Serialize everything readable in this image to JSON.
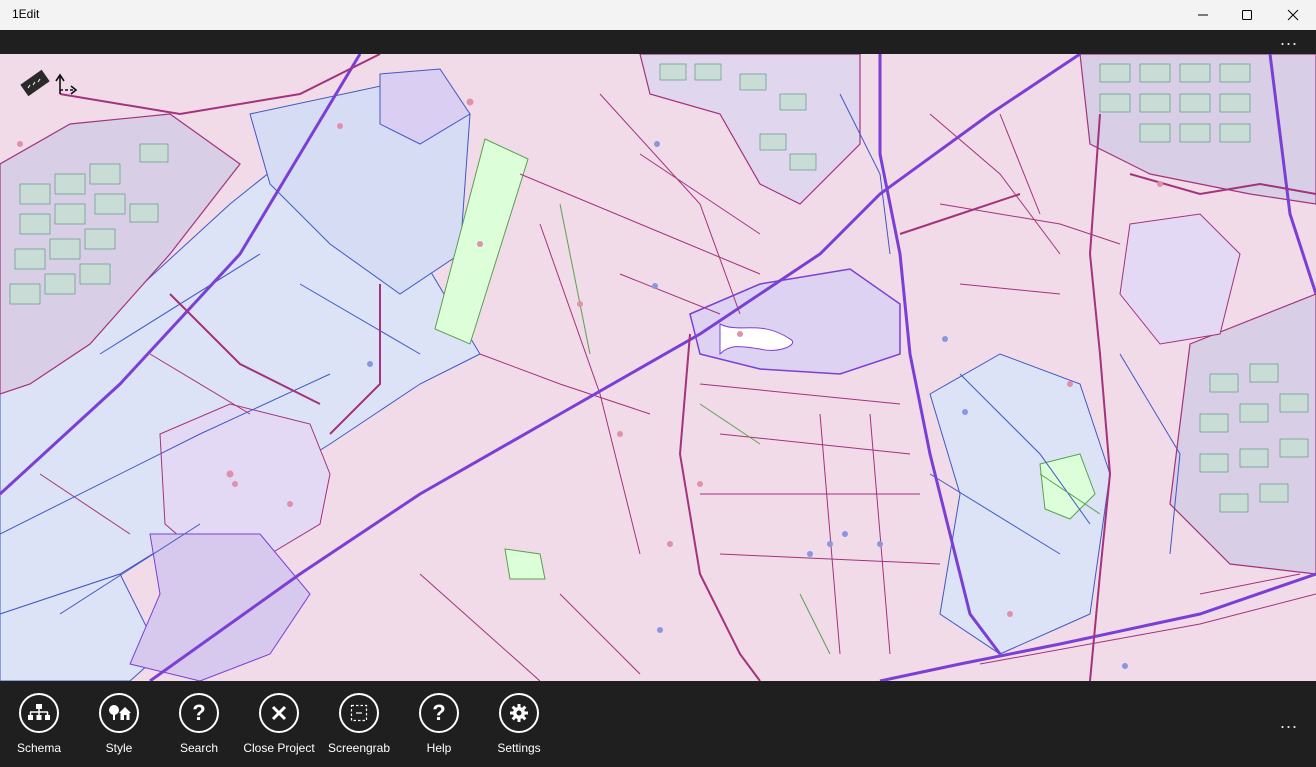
{
  "window": {
    "title": "1Edit",
    "controls": {
      "minimize_icon": "minimize-icon",
      "maximize_icon": "maximize-icon",
      "close_icon": "close-icon"
    }
  },
  "topbar": {
    "more": "..."
  },
  "map": {
    "tools": [
      {
        "name": "measure-ruler",
        "icon": "ruler-icon"
      },
      {
        "name": "coordinate-axes",
        "icon": "axes-icon"
      }
    ],
    "colors": {
      "field": "#f1dbe9",
      "parcel_blue": "#dce3f6",
      "parcel_lavender": "#e3d9f4",
      "green_area": "#dcffd9",
      "road_major": "#7b3fd6",
      "road_minor": "#a4327c",
      "boundary": "#3f58c4",
      "water": "#ffffff"
    }
  },
  "appbar": {
    "buttons": [
      {
        "label": "Schema",
        "icon": "schema-icon"
      },
      {
        "label": "Style",
        "icon": "style-icon"
      },
      {
        "label": "Search",
        "icon": "question-icon"
      },
      {
        "label": "Close Project",
        "icon": "close-circle-icon"
      },
      {
        "label": "Screengrab",
        "icon": "screengrab-icon"
      },
      {
        "label": "Help",
        "icon": "help-icon"
      },
      {
        "label": "Settings",
        "icon": "gear-icon"
      }
    ],
    "more": "..."
  }
}
